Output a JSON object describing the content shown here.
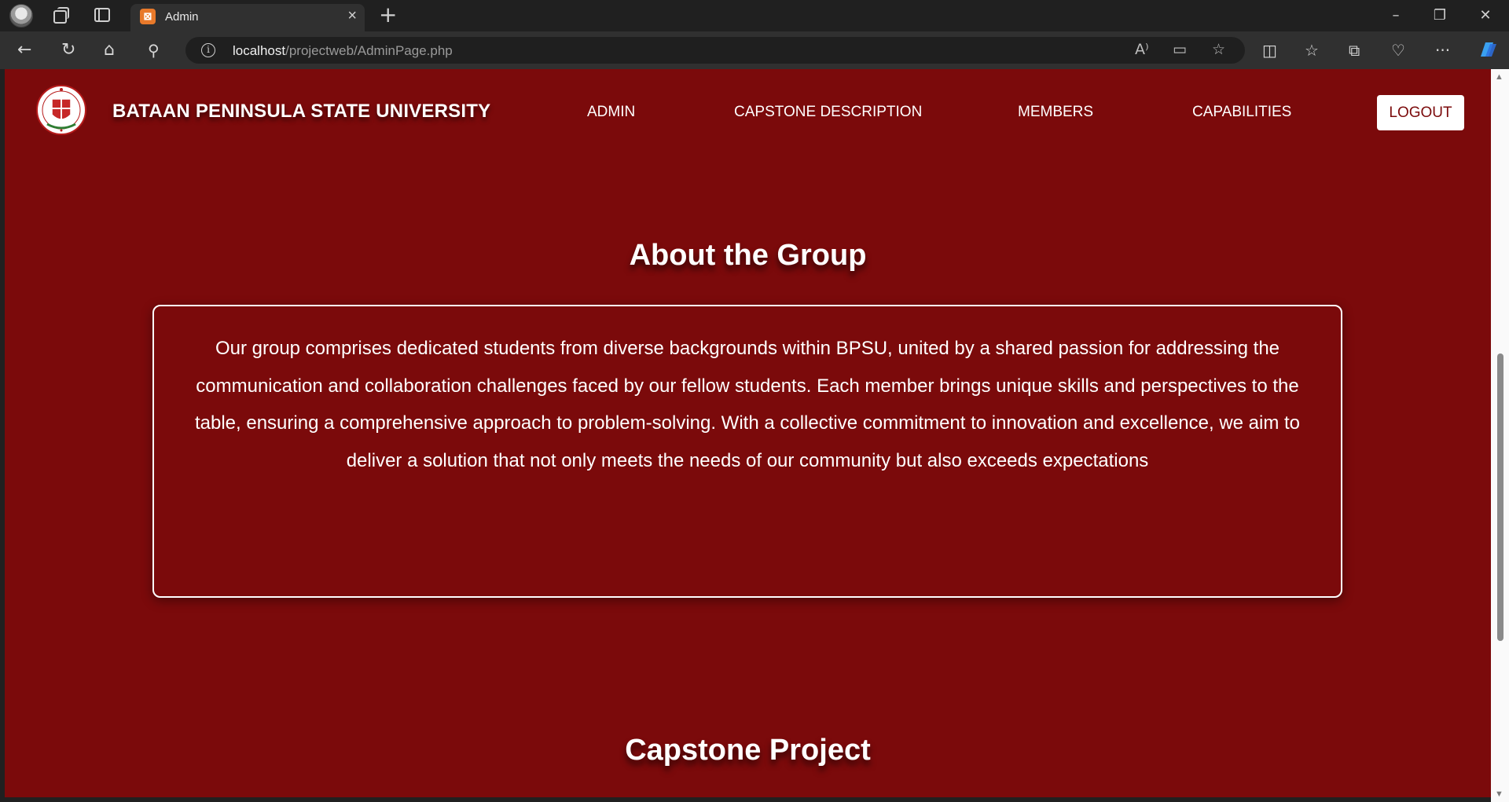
{
  "browser": {
    "tab_title": "Admin",
    "url_host": "localhost",
    "url_path": "/projectweb/AdminPage.php"
  },
  "site": {
    "brand": "BATAAN PENINSULA STATE UNIVERSITY",
    "nav": {
      "admin": "ADMIN",
      "capstone": "CAPSTONE DESCRIPTION",
      "members": "MEMBERS",
      "capabilities": "CAPABILITIES",
      "logout": "LOGOUT"
    }
  },
  "about": {
    "title": "About the Group",
    "text": "Our group comprises dedicated students from diverse backgrounds within BPSU, united by a shared passion for addressing the communication and collaboration challenges faced by our fellow students. Each member brings unique skills and perspectives to the table, ensuring a comprehensive approach to problem-solving. With a collective commitment to innovation and excellence, we aim to deliver a solution that not only meets the needs of our community but also exceeds expectations"
  },
  "capstone": {
    "title": "Capstone Project"
  },
  "colors": {
    "page_background": "#7b0a0b",
    "text": "#ffffff",
    "logout_background": "#ffffff"
  }
}
